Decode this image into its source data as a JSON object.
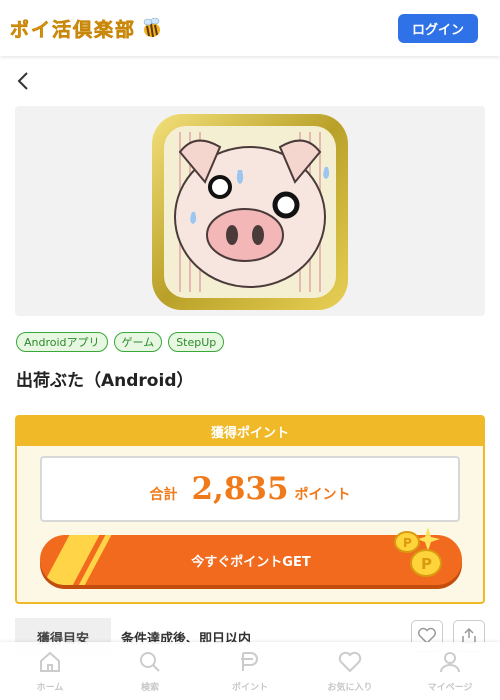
{
  "header": {
    "logo_text": "ポイ活倶楽部",
    "login_label": "ログイン"
  },
  "tags": [
    "Androidアプリ",
    "ゲーム",
    "StepUp"
  ],
  "app": {
    "title": "出荷ぶた（Android）"
  },
  "points": {
    "heading": "獲得ポイント",
    "total_label": "合計",
    "total_value": "2,835",
    "unit": "ポイント",
    "cta_label": "今すぐポイントGET"
  },
  "estimate": {
    "label": "獲得目安",
    "value": "条件達成後、即日以内"
  },
  "bottom_nav": [
    {
      "label": "ホーム",
      "icon": "home-icon"
    },
    {
      "label": "検索",
      "icon": "search-icon"
    },
    {
      "label": "ポイント",
      "icon": "point-icon"
    },
    {
      "label": "お気に入り",
      "icon": "heart-icon"
    },
    {
      "label": "マイページ",
      "icon": "user-icon"
    }
  ],
  "colors": {
    "accent_blue": "#2f72e8",
    "gold": "#f0b928",
    "orange": "#f26a1e",
    "tag_green": "#38a838"
  }
}
